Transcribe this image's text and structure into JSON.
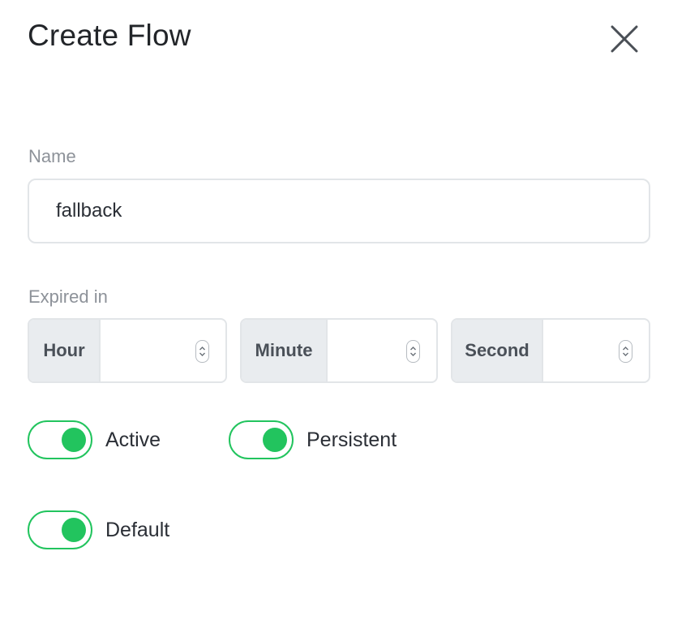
{
  "dialog": {
    "title": "Create Flow",
    "close_icon": "close-icon"
  },
  "name_field": {
    "label": "Name",
    "value": "fallback"
  },
  "expired_in": {
    "label": "Expired in",
    "hour_label": "Hour",
    "hour_value": "",
    "minute_label": "Minute",
    "minute_value": "",
    "second_label": "Second",
    "second_value": ""
  },
  "toggles": {
    "active": {
      "label": "Active",
      "on": true
    },
    "persistent": {
      "label": "Persistent",
      "on": true
    },
    "default": {
      "label": "Default",
      "on": true
    }
  },
  "colors": {
    "toggle_on": "#22c45e",
    "addon_bg": "#e9ecef",
    "border": "#e2e5e8",
    "label": "#8d9299"
  }
}
